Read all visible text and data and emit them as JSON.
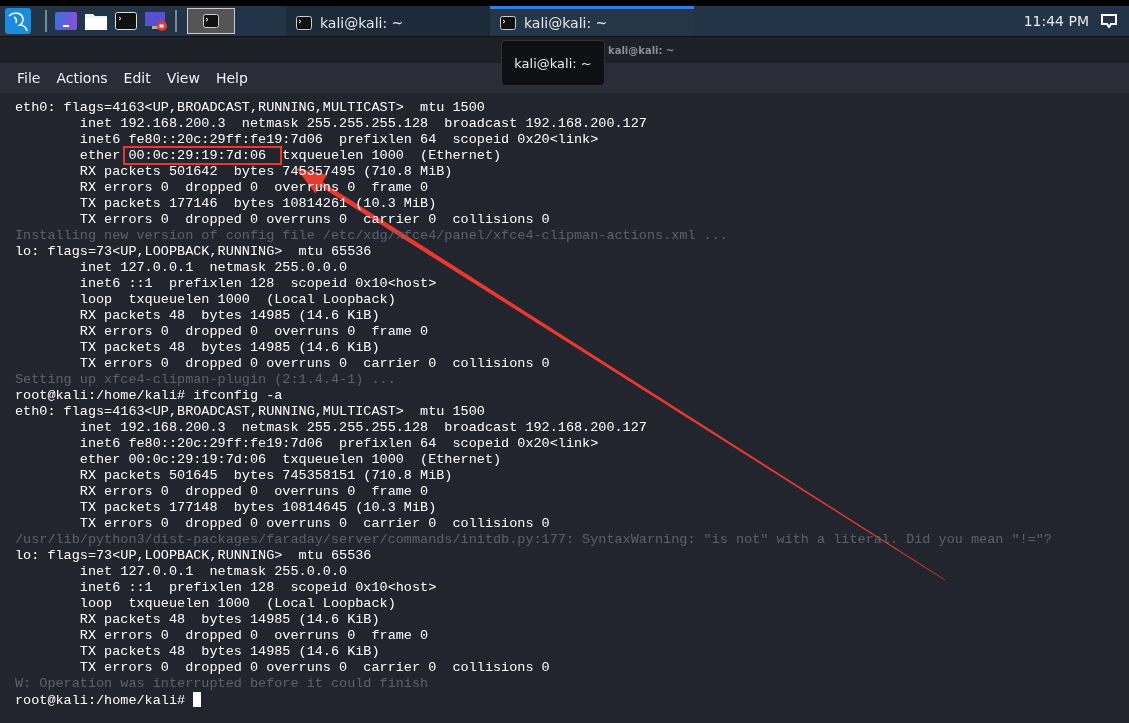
{
  "taskbar": {
    "launchers": [
      {
        "kind": "workspace"
      },
      {
        "kind": "folder"
      },
      {
        "kind": "terminal"
      },
      {
        "kind": "recorder"
      }
    ],
    "active_task": {
      "kind": "terminal",
      "selected": true
    },
    "windows": [
      {
        "label": "kali@kali: ~",
        "selected": false
      },
      {
        "label": "kali@kali: ~",
        "selected": true
      }
    ],
    "clock": "11:44 PM"
  },
  "window": {
    "title": "kali@kali: ~",
    "tooltip": "kali@kali: ~"
  },
  "menu": [
    "File",
    "Actions",
    "Edit",
    "View",
    "Help"
  ],
  "terminal": {
    "lines": [
      {
        "kind": "output",
        "text": "eth0: flags=4163<UP,BROADCAST,RUNNING,MULTICAST>  mtu 1500"
      },
      {
        "kind": "output",
        "text": "        inet 192.168.200.3  netmask 255.255.255.128  broadcast 192.168.200.127"
      },
      {
        "kind": "output",
        "text": "        inet6 fe80::20c:29ff:fe19:7d06  prefixlen 64  scopeid 0x20<link>"
      },
      {
        "kind": "output",
        "segments": [
          {
            "text": "        ether ",
            "boxed": false
          },
          {
            "text": "00:0c:29:19:7d:06",
            "boxed": true
          },
          {
            "text": "  txqueuelen 1000  (Ethernet)",
            "boxed": false
          }
        ]
      },
      {
        "kind": "output",
        "text": "        RX packets 501642  bytes 745357495 (710.8 MiB)"
      },
      {
        "kind": "output",
        "text": "        RX errors 0  dropped 0  overruns 0  frame 0"
      },
      {
        "kind": "output",
        "text": "        TX packets 177146  bytes 10814261 (10.3 MiB)"
      },
      {
        "kind": "output",
        "text": "        TX errors 0  dropped 0 overruns 0  carrier 0  collisions 0"
      },
      {
        "kind": "ghost",
        "text": "Installing new version of config file /etc/xdg/xfce4/panel/xfce4-clipman-actions.xml ..."
      },
      {
        "kind": "output",
        "text": "lo: flags=73<UP,LOOPBACK,RUNNING>  mtu 65536"
      },
      {
        "kind": "output",
        "text": "        inet 127.0.0.1  netmask 255.0.0.0"
      },
      {
        "kind": "output",
        "text": "        inet6 ::1  prefixlen 128  scopeid 0x10<host>"
      },
      {
        "kind": "output",
        "text": "        loop  txqueuelen 1000  (Local Loopback)"
      },
      {
        "kind": "output",
        "text": "        RX packets 48  bytes 14985 (14.6 KiB)"
      },
      {
        "kind": "output",
        "text": "        RX errors 0  dropped 0  overruns 0  frame 0"
      },
      {
        "kind": "output",
        "text": "        TX packets 48  bytes 14985 (14.6 KiB)"
      },
      {
        "kind": "output",
        "text": "        TX errors 0  dropped 0 overruns 0  carrier 0  collisions 0"
      },
      {
        "kind": "ghost",
        "text": "Setting up xfce4-clipman-plugin (2:1.4.4-1) ..."
      },
      {
        "kind": "output",
        "text": "root@kali:/home/kali# ifconfig -a"
      },
      {
        "kind": "output",
        "text": "eth0: flags=4163<UP,BROADCAST,RUNNING,MULTICAST>  mtu 1500"
      },
      {
        "kind": "output",
        "text": "        inet 192.168.200.3  netmask 255.255.255.128  broadcast 192.168.200.127"
      },
      {
        "kind": "output",
        "text": "        inet6 fe80::20c:29ff:fe19:7d06  prefixlen 64  scopeid 0x20<link>"
      },
      {
        "kind": "output",
        "text": "        ether 00:0c:29:19:7d:06  txqueuelen 1000  (Ethernet)"
      },
      {
        "kind": "output",
        "text": "        RX packets 501645  bytes 745358151 (710.8 MiB)"
      },
      {
        "kind": "output",
        "text": "        RX errors 0  dropped 0  overruns 0  frame 0"
      },
      {
        "kind": "output",
        "text": "        TX packets 177148  bytes 10814645 (10.3 MiB)"
      },
      {
        "kind": "output",
        "text": "        TX errors 0  dropped 0 overruns 0  carrier 0  collisions 0"
      },
      {
        "kind": "ghost",
        "text": "/usr/lib/python3/dist-packages/faraday/server/commands/initdb.py:177: SyntaxWarning: \"is not\" with a literal. Did you mean \"!=\"?"
      },
      {
        "kind": "output",
        "text": "lo: flags=73<UP,LOOPBACK,RUNNING>  mtu 65536"
      },
      {
        "kind": "output",
        "text": "        inet 127.0.0.1  netmask 255.0.0.0"
      },
      {
        "kind": "output",
        "text": "        inet6 ::1  prefixlen 128  scopeid 0x10<host>"
      },
      {
        "kind": "output",
        "text": "        loop  txqueuelen 1000  (Local Loopback)"
      },
      {
        "kind": "output",
        "text": "        RX packets 48  bytes 14985 (14.6 KiB)"
      },
      {
        "kind": "output",
        "text": "        RX errors 0  dropped 0  overruns 0  frame 0"
      },
      {
        "kind": "output",
        "text": "        TX packets 48  bytes 14985 (14.6 KiB)"
      },
      {
        "kind": "output",
        "text": "        TX errors 0  dropped 0 overruns 0  carrier 0  collisions 0"
      },
      {
        "kind": "ghost",
        "text": "W: Operation was interrupted before it could finish"
      }
    ],
    "prompt": "root@kali:/home/kali# ",
    "annotations": [
      {
        "kind": "arrow"
      }
    ]
  }
}
